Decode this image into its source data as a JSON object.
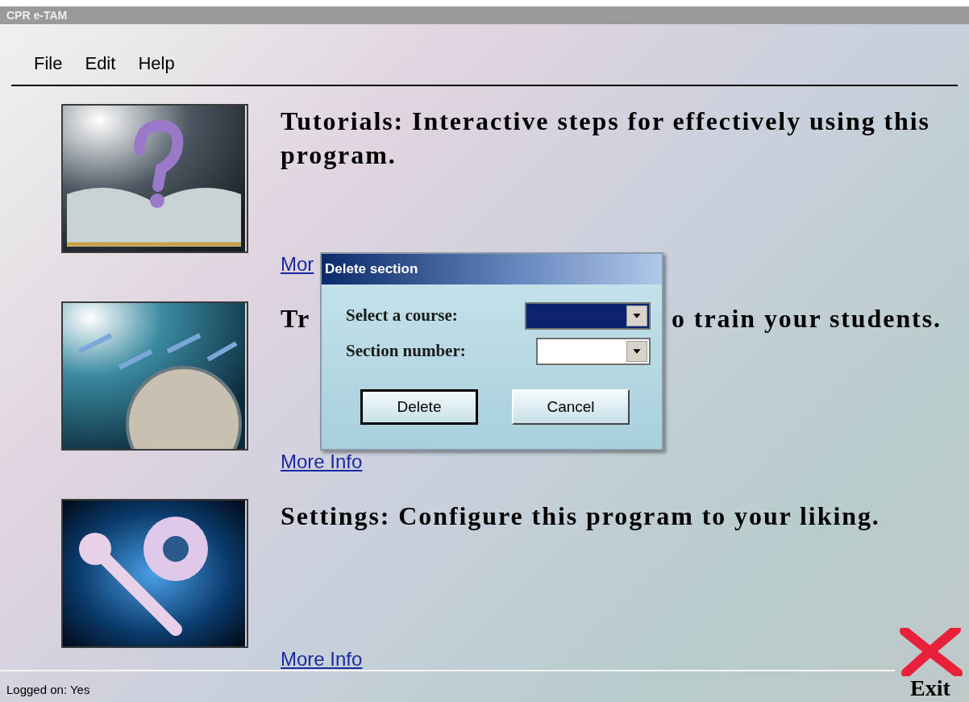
{
  "window": {
    "title": "CPR e-TAM"
  },
  "menu": [
    "File",
    "Edit",
    "Help"
  ],
  "sections": [
    {
      "kind": "tutorials",
      "title_parts": [
        "Tutorials: Interactive steps for effectively using this program."
      ],
      "link": "Mor"
    },
    {
      "kind": "training",
      "title_parts": [
        "Tr",
        "o train your students."
      ],
      "link": "More Info"
    },
    {
      "kind": "settings",
      "title_parts": [
        "Settings: Configure this program to your liking."
      ],
      "link": "More Info"
    }
  ],
  "dialog": {
    "title": "Delete section",
    "fields": [
      {
        "label": "Select a course:",
        "selected": true
      },
      {
        "label": "Section number:",
        "selected": false
      }
    ],
    "buttons": [
      {
        "label": "Delete",
        "default": true
      },
      {
        "label": "Cancel",
        "default": false
      }
    ]
  },
  "status_bar": {
    "text": "Logged on: Yes"
  },
  "exit": {
    "label": "Exit"
  }
}
